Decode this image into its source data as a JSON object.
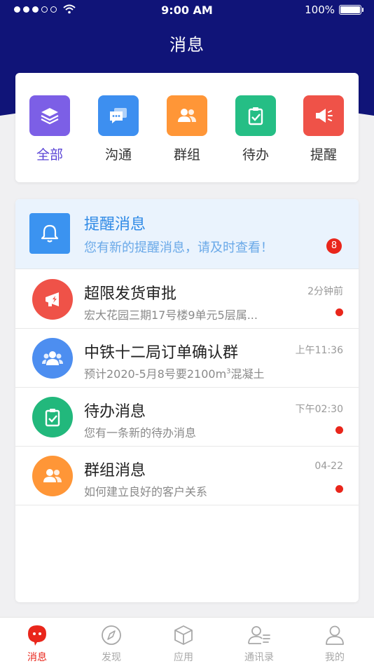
{
  "status": {
    "time": "9:00 AM",
    "battery": "100%"
  },
  "header": {
    "title": "消息"
  },
  "categories": [
    {
      "label": "全部",
      "icon": "layers-icon",
      "color": "#7c5fe6",
      "active": true
    },
    {
      "label": "沟通",
      "icon": "chat-icon",
      "color": "#3d8ff0"
    },
    {
      "label": "群组",
      "icon": "group-icon",
      "color": "#ff9637"
    },
    {
      "label": "待办",
      "icon": "clipboard-check-icon",
      "color": "#25be85"
    },
    {
      "label": "提醒",
      "icon": "megaphone-icon",
      "color": "#ef5248"
    }
  ],
  "reminder": {
    "title": "提醒消息",
    "subtitle": "您有新的提醒消息，请及时查看！",
    "badge": "8",
    "icon": "bell-icon"
  },
  "messages": [
    {
      "title": "超限发货审批",
      "subtitle": "宏大花园三期17号楼9单元5层属...",
      "time": "2分钟前",
      "unread": true,
      "icon": "megaphone-icon",
      "color": "#ef5248"
    },
    {
      "title": "中铁十二局订单确认群",
      "subtitle_pre": "预计2020-5月8号要2100m",
      "subtitle_sup": "3",
      "subtitle_post": "混凝土",
      "time": "上午11:36",
      "unread": false,
      "icon": "group-icon",
      "color": "#4d8ef0"
    },
    {
      "title": "待办消息",
      "subtitle": "您有一条新的待办消息",
      "time": "下午02:30",
      "unread": true,
      "icon": "clipboard-check-icon",
      "color": "#22b87c"
    },
    {
      "title": "群组消息",
      "subtitle": "如何建立良好的客户关系",
      "time": "04-22",
      "unread": true,
      "icon": "group-icon",
      "color": "#ff9637"
    }
  ],
  "tabs": [
    {
      "label": "消息",
      "icon": "message-bubble-icon",
      "active": true
    },
    {
      "label": "发现",
      "icon": "compass-icon"
    },
    {
      "label": "应用",
      "icon": "cube-icon"
    },
    {
      "label": "通讯录",
      "icon": "contacts-icon"
    },
    {
      "label": "我的",
      "icon": "user-icon"
    }
  ],
  "colors": {
    "header_bg": "#101478",
    "accent": "#5b45d6",
    "badge_red": "#e9261b"
  }
}
